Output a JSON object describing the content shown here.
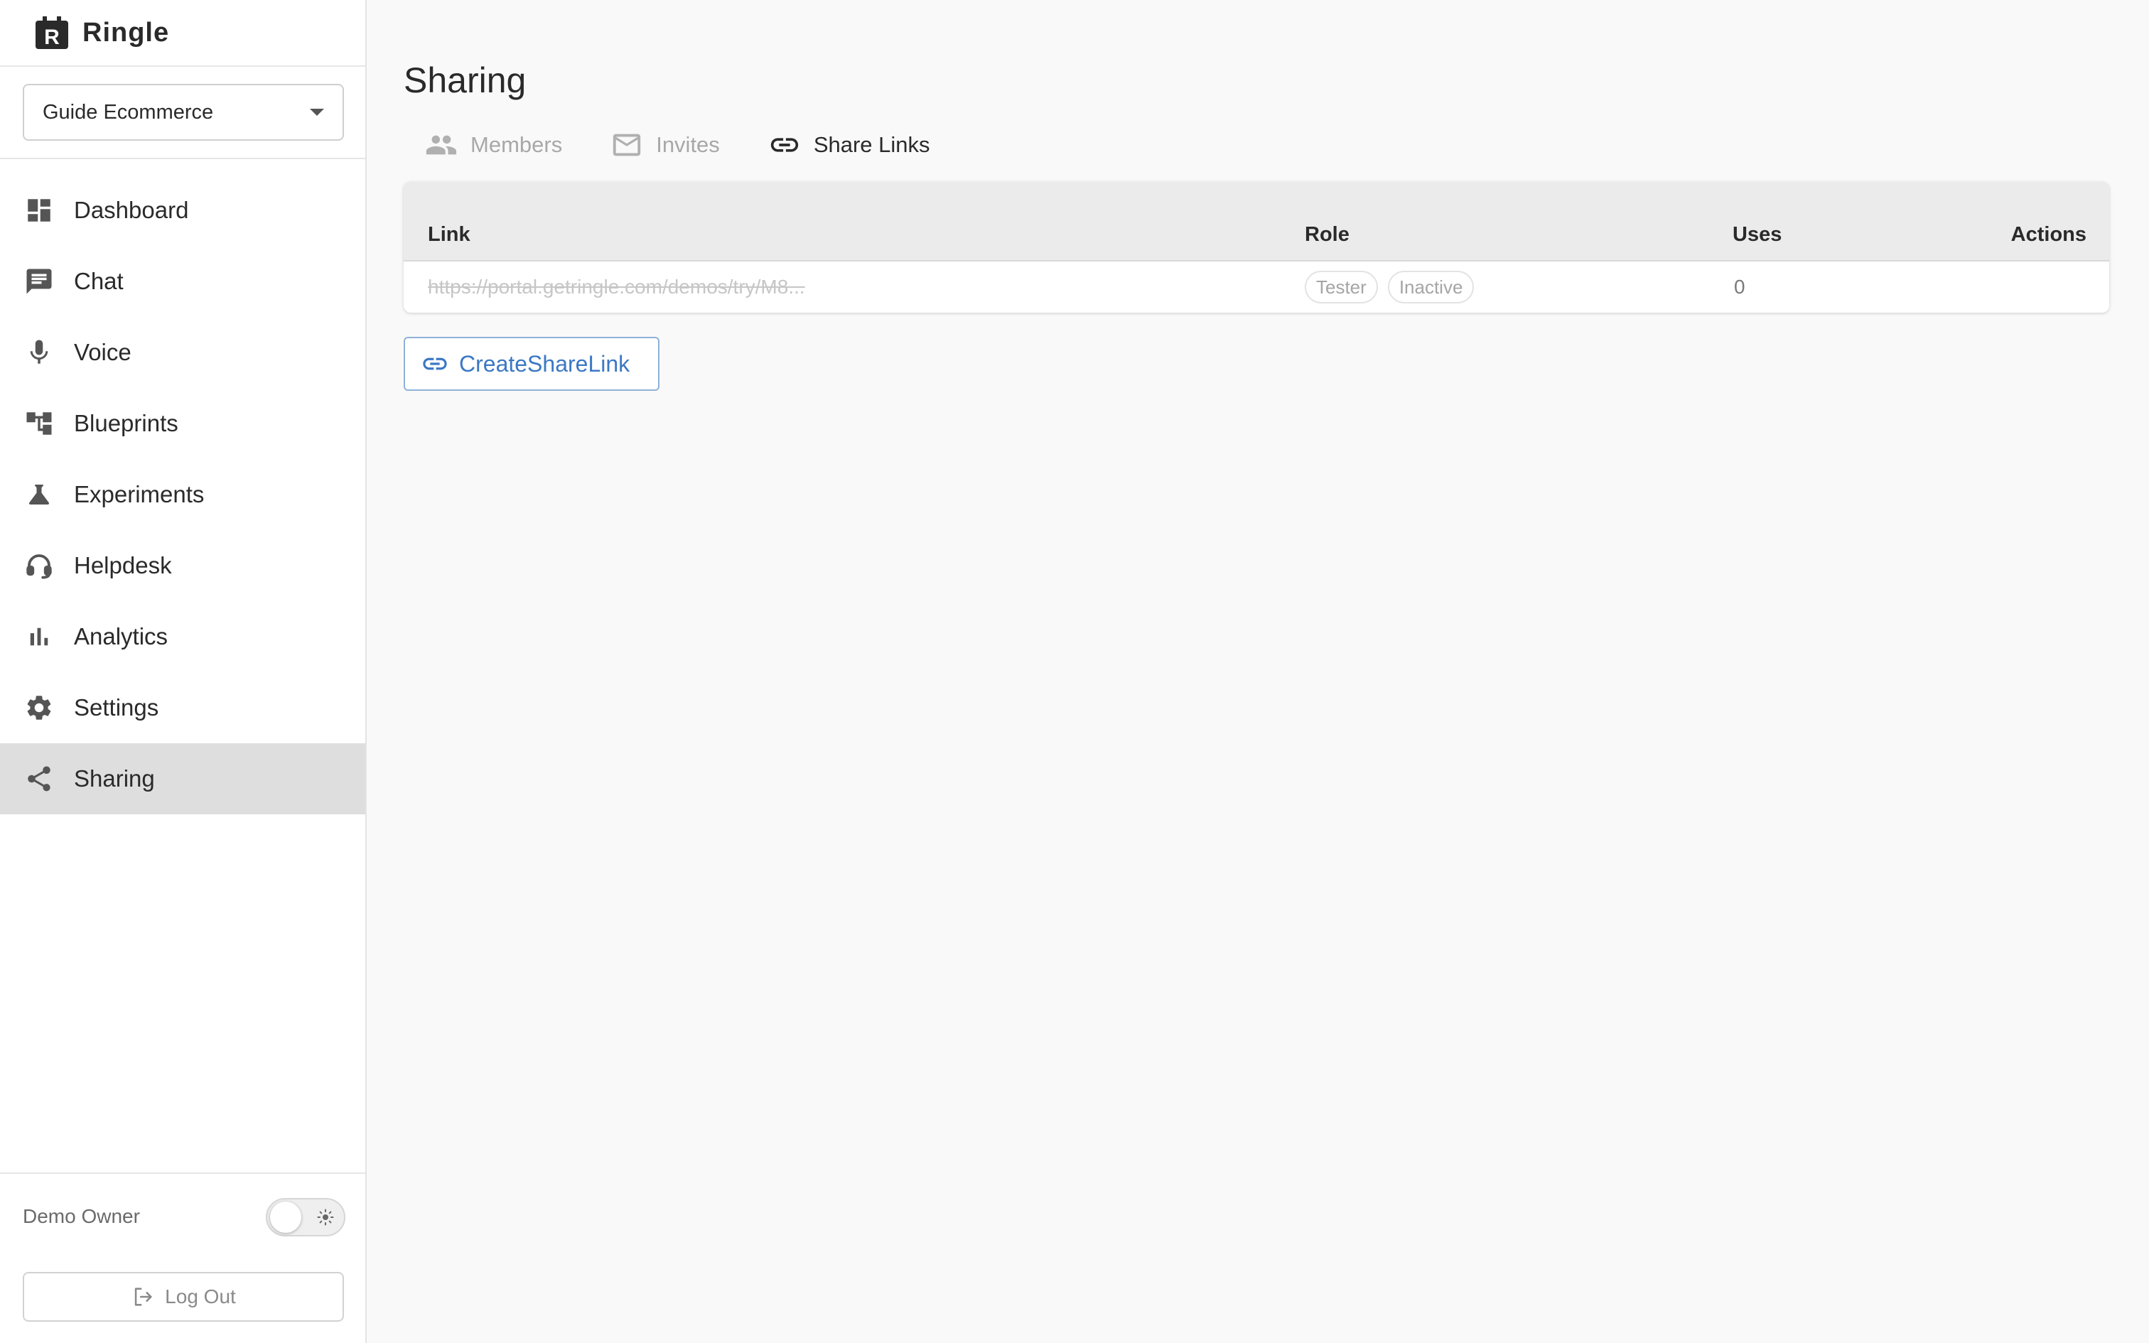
{
  "app": {
    "name": "Ringle"
  },
  "workspace": {
    "selected": "Guide Ecommerce"
  },
  "nav": {
    "items": [
      {
        "label": "Dashboard",
        "icon": "dashboard-icon"
      },
      {
        "label": "Chat",
        "icon": "chat-icon"
      },
      {
        "label": "Voice",
        "icon": "microphone-icon"
      },
      {
        "label": "Blueprints",
        "icon": "blueprints-icon"
      },
      {
        "label": "Experiments",
        "icon": "flask-icon"
      },
      {
        "label": "Helpdesk",
        "icon": "headset-icon"
      },
      {
        "label": "Analytics",
        "icon": "bar-chart-icon"
      },
      {
        "label": "Settings",
        "icon": "gear-icon"
      },
      {
        "label": "Sharing",
        "icon": "share-icon",
        "active": true
      }
    ]
  },
  "footer": {
    "user_name": "Demo Owner",
    "theme": "light",
    "logout_label": "Log Out"
  },
  "page": {
    "title": "Sharing"
  },
  "tabs": [
    {
      "label": "Members",
      "icon": "people-icon",
      "active": false
    },
    {
      "label": "Invites",
      "icon": "mail-icon",
      "active": false
    },
    {
      "label": "Share Links",
      "icon": "link-icon",
      "active": true
    }
  ],
  "table": {
    "headers": {
      "link": "Link",
      "role": "Role",
      "uses": "Uses",
      "actions": "Actions"
    },
    "rows": [
      {
        "link": "https://portal.getringle.com/demos/try/M8...",
        "role": "Tester",
        "status": "Inactive",
        "uses": "0"
      }
    ]
  },
  "create_button": {
    "label": "CreateShareLink"
  },
  "colors": {
    "accent": "#3b78c4",
    "active_nav_bg": "#dedede",
    "table_header_bg": "#ebebeb"
  }
}
